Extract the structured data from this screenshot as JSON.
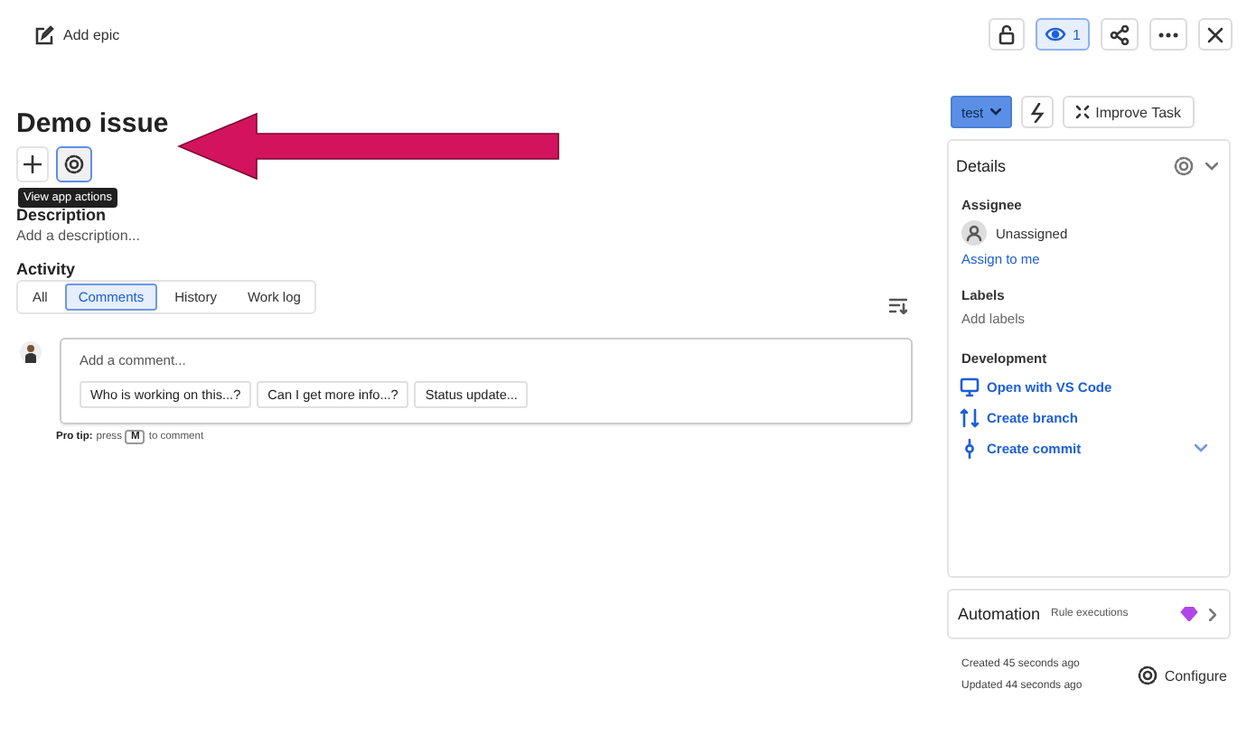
{
  "header": {
    "add_epic": "Add epic",
    "watchers": "1",
    "watching": true
  },
  "issue": {
    "title": "Demo issue",
    "tooltip": "View app actions",
    "description_heading": "Description",
    "description_placeholder": "Add a description..."
  },
  "activity": {
    "heading": "Activity",
    "tabs": [
      {
        "label": "All",
        "selected": false
      },
      {
        "label": "Comments",
        "selected": true
      },
      {
        "label": "History",
        "selected": false
      },
      {
        "label": "Work log",
        "selected": false
      }
    ],
    "comment": {
      "placeholder": "Add a comment...",
      "suggestions": [
        "Who is working on this...?",
        "Can I get more info...?",
        "Status update..."
      ]
    },
    "pro_tip": {
      "label": "Pro tip:",
      "before": "press",
      "key": "M",
      "after": "to comment"
    }
  },
  "sidebar": {
    "status": "test",
    "improve": "Improve Task",
    "details": {
      "title": "Details",
      "assignee_label": "Assignee",
      "assignee": "Unassigned",
      "assign_me": "Assign to me",
      "labels_label": "Labels",
      "labels_placeholder": "Add labels",
      "development_label": "Development",
      "dev_links": [
        {
          "kind": "code",
          "label": "Open with VS Code"
        },
        {
          "kind": "branch",
          "label": "Create branch"
        },
        {
          "kind": "commit",
          "label": "Create commit"
        }
      ]
    },
    "automation": {
      "title": "Automation",
      "subtitle": "Rule executions"
    },
    "created": "Created 45 seconds ago",
    "updated": "Updated 44 seconds ago",
    "configure": "Configure"
  }
}
